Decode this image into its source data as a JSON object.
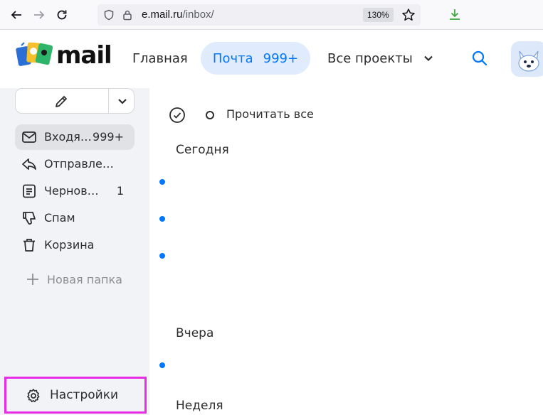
{
  "browser": {
    "url_host": "e.mail.ru",
    "url_path": "/inbox/",
    "zoom": "130%"
  },
  "header": {
    "logo_text": "mail",
    "nav_main": "Главная",
    "nav_mail": "Почта",
    "nav_mail_count": "999+",
    "nav_projects": "Все проекты"
  },
  "sidebar": {
    "folders": [
      {
        "label": "Входящие",
        "count": "999+",
        "icon": "inbox-icon"
      },
      {
        "label": "Отправленные",
        "count": "",
        "icon": "sent-icon"
      },
      {
        "label": "Черновики",
        "count": "1",
        "icon": "drafts-icon"
      },
      {
        "label": "Спам",
        "count": "",
        "icon": "spam-icon"
      },
      {
        "label": "Корзина",
        "count": "",
        "icon": "trash-icon"
      }
    ],
    "new_folder": "Новая папка",
    "settings": "Настройки"
  },
  "content": {
    "read_all": "Прочитать все",
    "groups": [
      "Сегодня",
      "Вчера",
      "Неделя"
    ]
  },
  "colors": {
    "accent": "#0077ff",
    "highlight_border": "#e62ee5"
  }
}
